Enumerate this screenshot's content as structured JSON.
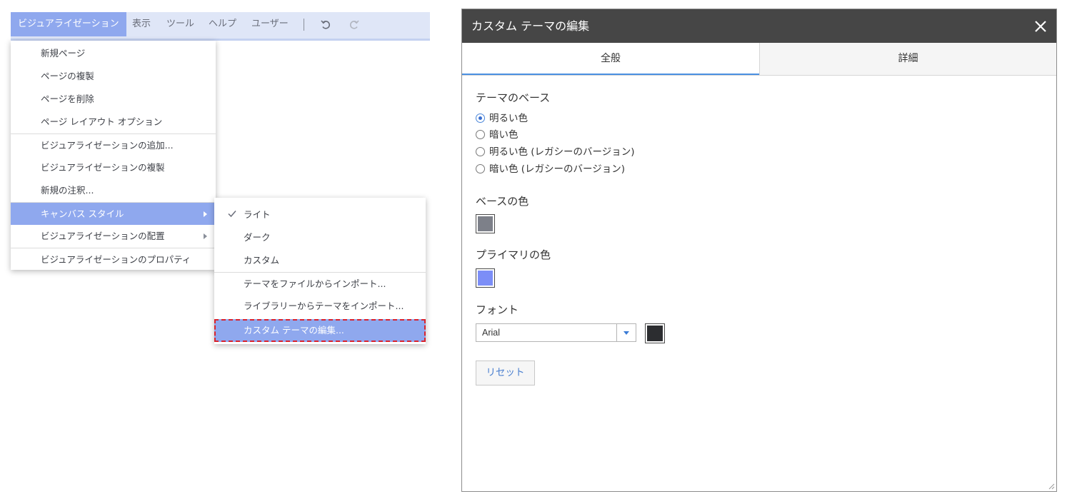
{
  "menubar": {
    "items": [
      "ビジュアライゼーション",
      "表示",
      "ツール",
      "ヘルプ",
      "ユーザー"
    ],
    "separator": "|",
    "undo_icon": "undo-icon",
    "redo_icon": "redo-icon"
  },
  "main_menu": {
    "items": [
      "新規ページ",
      "ページの複製",
      "ページを削除",
      "ページ レイアウト オプション",
      "ビジュアライゼーションの追加...",
      "ビジュアライゼーションの複製",
      "新規の注釈...",
      "キャンバス スタイル",
      "ビジュアライゼーションの配置",
      "ビジュアライゼーションのプロパティ"
    ]
  },
  "canvas_style_submenu": {
    "items": [
      "ライト",
      "ダーク",
      "カスタム",
      "テーマをファイルからインポート...",
      "ライブラリーからテーマをインポート...",
      "カスタム テーマの編集..."
    ],
    "checked_icon": "check-icon"
  },
  "dialog": {
    "title": "カスタム テーマの編集",
    "close_icon": "close-icon",
    "tabs": [
      "全般",
      "詳細"
    ],
    "theme_base_label": "テーマのベース",
    "theme_options": [
      "明るい色",
      "暗い色",
      "明るい色 (レガシーのバージョン)",
      "暗い色 (レガシーのバージョン)"
    ],
    "selected_theme": "明るい色",
    "base_color_label": "ベースの色",
    "base_color": "#7d8089",
    "primary_color_label": "プライマリの色",
    "primary_color": "#7c8ef7",
    "font_label": "フォント",
    "font_value": "Arial",
    "font_color": "#2c2d30",
    "reset_label": "リセット"
  },
  "colors": {
    "menubar_bg": "#dfe6f7",
    "menu_highlight": "#8fa8ee",
    "dialog_titlebar": "#464646",
    "tab_active_underline": "#4a90e2",
    "focus_outline": "#d9232d"
  }
}
